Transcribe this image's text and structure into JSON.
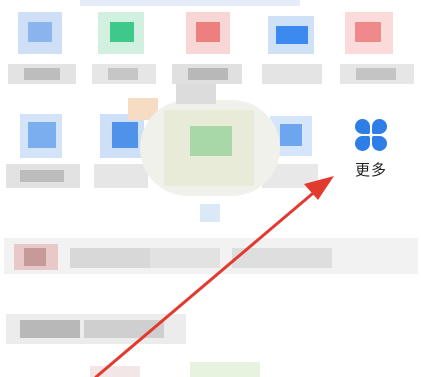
{
  "more_item": {
    "label": "更多",
    "icon": "grid-four-petal-icon",
    "icon_color": "#2f7de6"
  },
  "annotation": {
    "arrow_color": "#e23a2f"
  }
}
